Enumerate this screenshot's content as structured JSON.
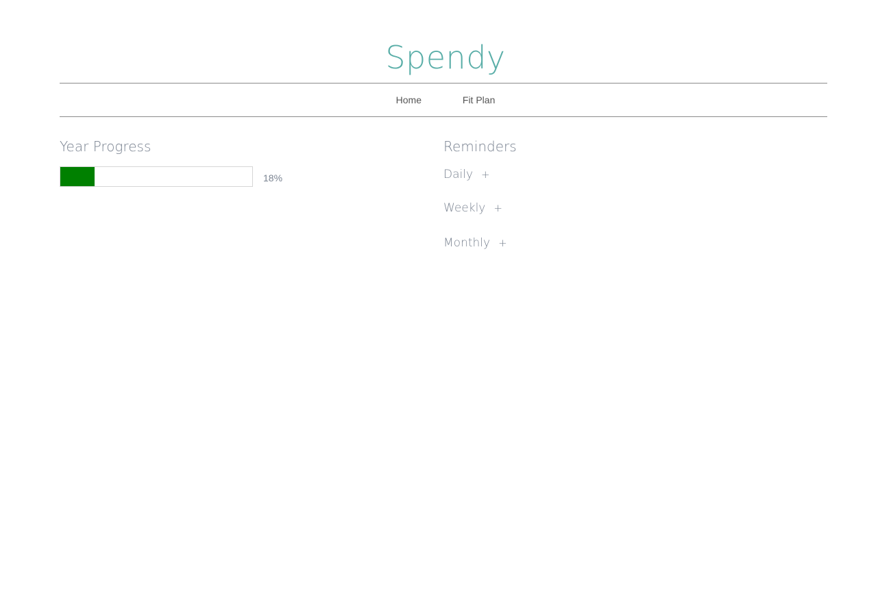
{
  "app": {
    "title": "Spendy",
    "accent_color": "#5aaea8"
  },
  "nav": {
    "items": [
      {
        "label": "Home"
      },
      {
        "label": "Fit Plan"
      }
    ]
  },
  "year_progress": {
    "heading": "Year Progress",
    "percent": 18,
    "label": "18%",
    "fill_color": "#008000"
  },
  "reminders": {
    "heading": "Reminders",
    "items": [
      {
        "label": "Daily",
        "add_icon": "+"
      },
      {
        "label": "Weekly",
        "add_icon": "+"
      },
      {
        "label": "Monthly",
        "add_icon": "+"
      }
    ]
  }
}
